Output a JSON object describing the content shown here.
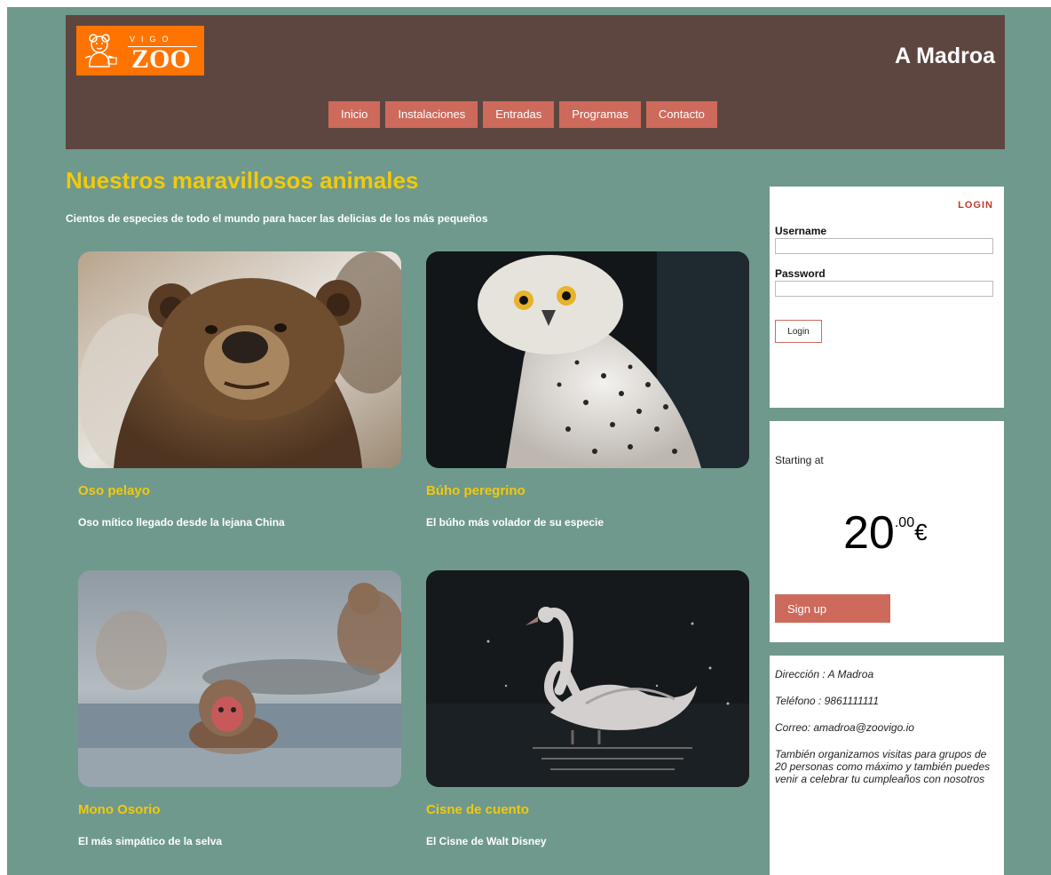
{
  "header": {
    "logo": {
      "top_text": "VIGO",
      "main_text": "ZOO"
    },
    "site_title": "A Madroa",
    "nav": [
      "Inicio",
      "Instalaciones",
      "Entradas",
      "Programas",
      "Contacto"
    ]
  },
  "main": {
    "title": "Nuestros maravillosos animales",
    "subtitle": "Cientos de especies de todo el mundo para hacer las delicias de los más pequeños",
    "animals": [
      {
        "name": "Oso pelayo",
        "description": "Oso mítico llegado desde la lejana China"
      },
      {
        "name": "Búho peregrino",
        "description": "El búho más volador de su especie"
      },
      {
        "name": "Mono Osorio",
        "description": "El más simpático de la selva"
      },
      {
        "name": "Cisne de cuento",
        "description": "El Cisne de Walt Disney"
      }
    ]
  },
  "login": {
    "heading": "LOGIN",
    "username_label": "Username",
    "password_label": "Password",
    "button_label": "Login"
  },
  "pricing": {
    "label": "Starting at",
    "price_integer": "20",
    "price_cents": ".00",
    "currency": "€",
    "signup_label": "Sign up"
  },
  "contact": {
    "address": "Dirección : A Madroa",
    "phone": "Teléfono : 9861111111",
    "email": "Correo: amadroa@zoovigo.io",
    "note": "También organizamos visitas para grupos de 20 personas como máximo y también puedes venir a celebrar tu cumpleaños con nosotros"
  },
  "colors": {
    "background": "#6f998c",
    "header": "#5d4640",
    "accent": "#cd6a5c",
    "title_yellow": "#f2c90c",
    "logo_orange": "#ff7400"
  }
}
